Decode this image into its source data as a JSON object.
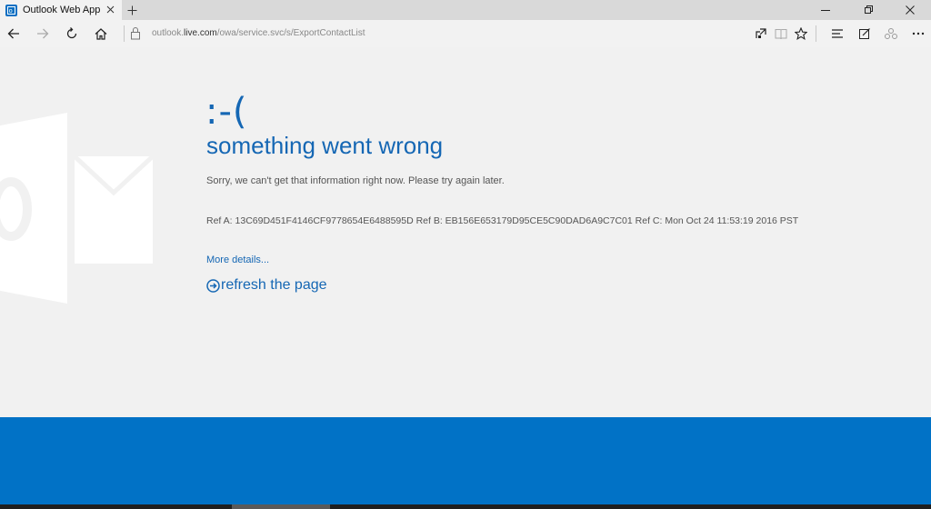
{
  "browser": {
    "tab_title": "Outlook Web App",
    "new_tab_symbol": "+",
    "url_prefix": "outlook.",
    "url_host": "live.com",
    "url_path": "/owa/service.svc/s/ExportContactList"
  },
  "error": {
    "face": ":-(",
    "headline": "something went wrong",
    "message": "Sorry, we can't get that information right now. Please try again later.",
    "refs": "Ref A: 13C69D451F4146CF9778654E6488595D Ref B: EB156E653179D95CE5C90DAD6A9C7C01 Ref C: Mon Oct 24 11:53:19 2016 PST",
    "more_details": "More details...",
    "refresh": "refresh the page"
  },
  "colors": {
    "accent": "#1567b4",
    "footer": "#0172c6"
  },
  "icons": {
    "tab_favicon": "outlook-icon",
    "back": "back-arrow-icon",
    "forward": "forward-arrow-icon",
    "refresh": "refresh-icon",
    "home": "home-icon",
    "lock": "lock-icon",
    "reading_view": "reading-view-icon",
    "favorite": "star-icon",
    "hub": "hub-icon",
    "web_note": "web-note-icon",
    "share": "share-icon",
    "more": "more-icon"
  }
}
